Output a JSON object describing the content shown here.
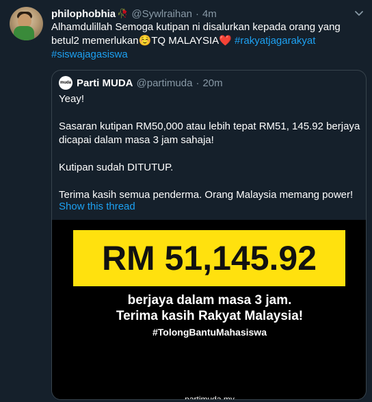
{
  "tweet": {
    "display_name": "philophobhia",
    "name_emoji": "🥀",
    "handle": "@Sywlraihan",
    "separator": "·",
    "time": "4m",
    "text_part1": "Alhamdulillah Semoga kutipan ni disalurkan kepada orang yang betul2 memerlukan",
    "emoji_smile": "☺️",
    "text_part2": "TQ MALAYSIA",
    "emoji_heart": "❤️",
    "hashtag1": "#rakyatjagarakyat",
    "hashtag2": "#siswajagasiswa"
  },
  "quote": {
    "avatar_text": "muda",
    "display_name": "Parti MUDA",
    "handle": "@partimuda",
    "separator": "·",
    "time": "20m",
    "paragraphs": [
      "Yeay!",
      "Sasaran kutipan RM50,000 atau lebih tepat RM51, 145.92 berjaya dicapai dalam masa 3 jam sahaja!",
      "Kutipan sudah DITUTUP.",
      "Terima kasih semua penderma. Orang Malaysia memang power!"
    ],
    "show_thread": "Show this thread"
  },
  "media": {
    "banner_amount": "RM 51,145.92",
    "line1": "berjaya dalam masa 3 jam.",
    "line2": "Terima kasih Rakyat Malaysia!",
    "hashtag": "#TolongBantuMahasiswa",
    "site": "partimuda.my"
  },
  "icons": {
    "caret": "chevron-down-icon"
  },
  "colors": {
    "background": "#15202b",
    "link": "#1da1f2",
    "muted": "#8899a6",
    "banner": "#ffe10e"
  }
}
